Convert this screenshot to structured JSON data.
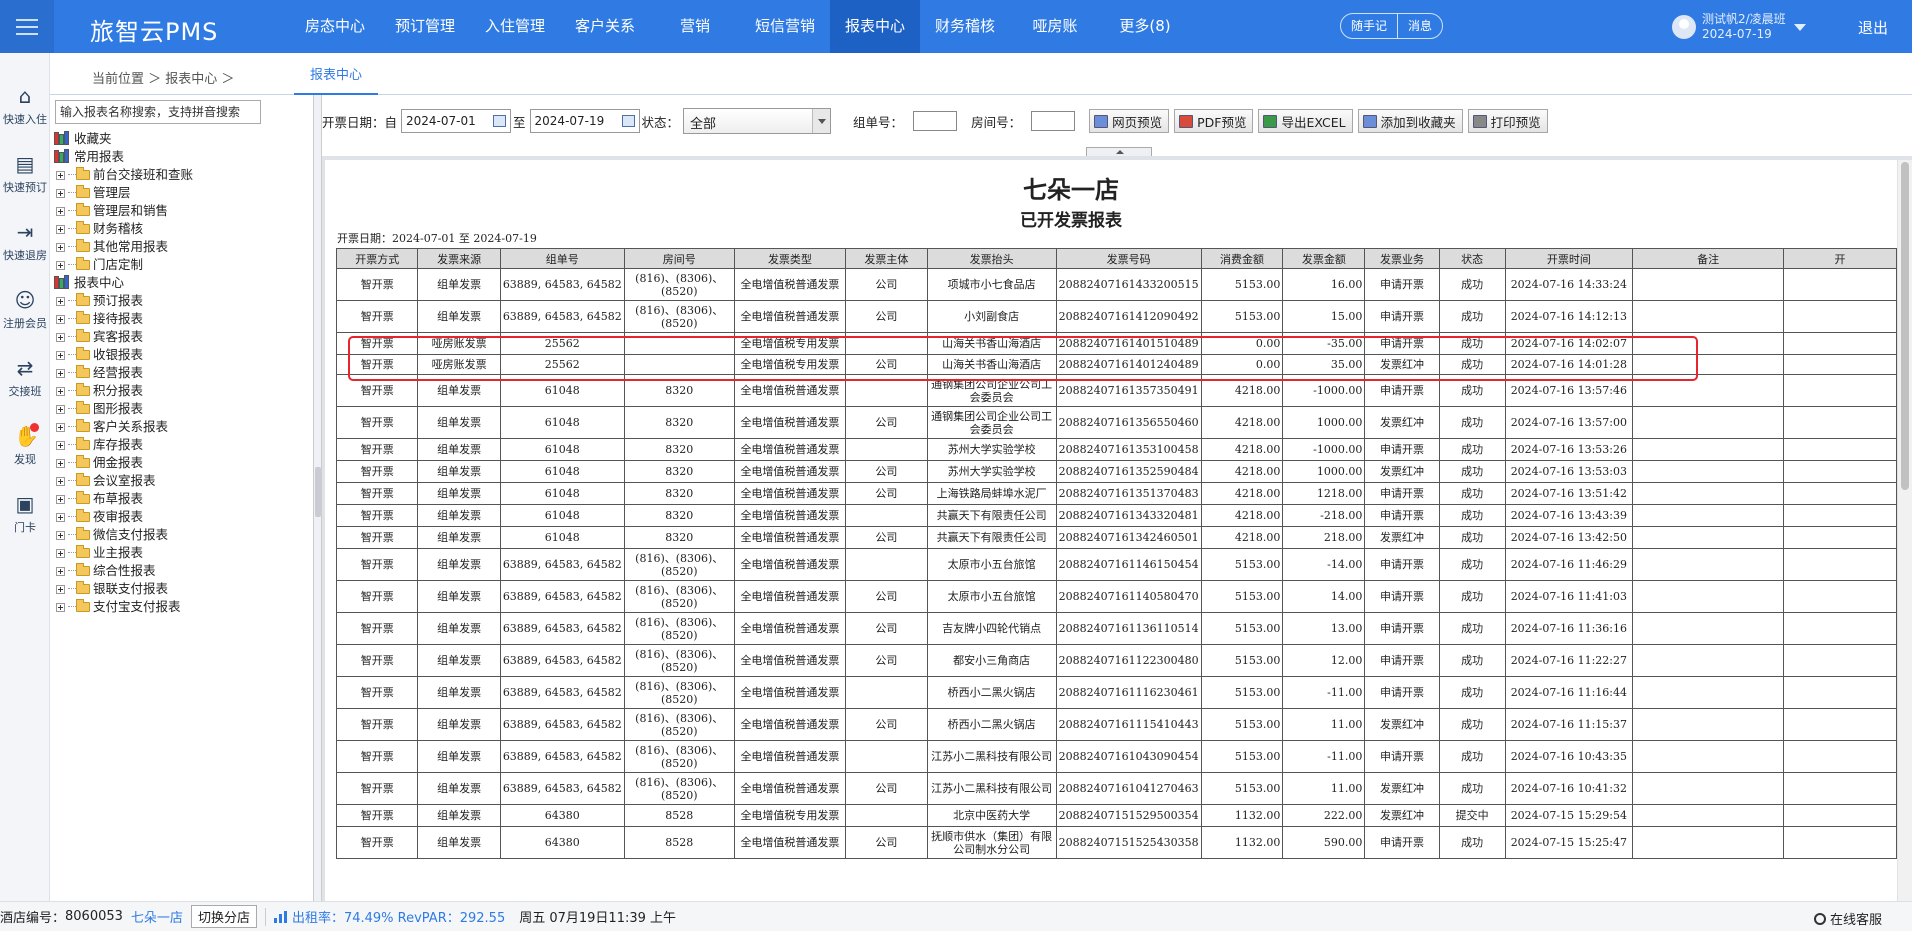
{
  "app": {
    "logo": "旅智云PMS"
  },
  "nav": {
    "items": [
      "房态中心",
      "预订管理",
      "入住管理",
      "客户关系",
      "营销",
      "短信营销",
      "报表中心",
      "财务稽核",
      "哑房账",
      "更多(8)"
    ],
    "active": 6
  },
  "quick": {
    "note": "随手记",
    "msg": "消息"
  },
  "user": {
    "name": "测试帆2/凌晨班",
    "date": "2024-07-19",
    "logout": "退出"
  },
  "leftbar": [
    {
      "label": "快速入住",
      "icon": "home-icon"
    },
    {
      "label": "快速预订",
      "icon": "booking-icon"
    },
    {
      "label": "快速退房",
      "icon": "checkout-icon"
    },
    {
      "label": "注册会员",
      "icon": "add-member-icon"
    },
    {
      "label": "交接班",
      "icon": "shift-handover-icon"
    },
    {
      "label": "发现",
      "icon": "discover-icon"
    },
    {
      "label": "门卡",
      "icon": "room-card-icon"
    }
  ],
  "breadcrumb": {
    "text": "当前位置 ＞ 报表中心 ＞",
    "tab": "报表中心"
  },
  "tree": {
    "search_placeholder": "输入报表名称搜索，支持拼音搜索",
    "favorites": "收藏夹",
    "common": "常用报表",
    "common_items": [
      "前台交接班和查账",
      "管理层",
      "管理层和销售",
      "财务稽核",
      "其他常用报表",
      "门店定制"
    ],
    "center": "报表中心",
    "center_items": [
      "预订报表",
      "接待报表",
      "宾客报表",
      "收银报表",
      "经营报表",
      "积分报表",
      "图形报表",
      "客户关系报表",
      "库存报表",
      "佣金报表",
      "会议室报表",
      "布草报表",
      "夜审报表",
      "微信支付报表",
      "业主报表",
      "综合性报表",
      "银联支付报表",
      "支付宝支付报表"
    ]
  },
  "filters": {
    "date_label": "开票日期：自",
    "start": "2024-07-01",
    "to": "至",
    "end": "2024-07-19",
    "status_label": "状态：",
    "status_value": "全部",
    "group_label": "组单号：",
    "room_label": "房间号：",
    "buttons": [
      "网页预览",
      "PDF预览",
      "导出EXCEL",
      "添加到收藏夹",
      "打印预览"
    ]
  },
  "report": {
    "title": "七朵一店",
    "subtitle": "已开发票报表",
    "range": "开票日期：2024-07-01 至 2024-07-19",
    "headers": [
      "开票方式",
      "发票来源",
      "组单号",
      "房间号",
      "发票类型",
      "发票主体",
      "发票抬头",
      "发票号码",
      "消费金额",
      "发票金额",
      "发票业务",
      "状态",
      "开票时间",
      "备注",
      "开"
    ],
    "rows": [
      [
        "智开票",
        "组单发票",
        "63889, 64583, 64582",
        "(816)、(8306)、(8520)",
        "全电增值税普通发票",
        "公司",
        "项城市小七食品店",
        "20882407161433200515",
        "5153.00",
        "16.00",
        "申请开票",
        "成功",
        "2024-07-16 14:33:24"
      ],
      [
        "智开票",
        "组单发票",
        "63889, 64583, 64582",
        "(816)、(8306)、(8520)",
        "全电增值税普通发票",
        "公司",
        "小刘副食店",
        "20882407161412090492",
        "5153.00",
        "15.00",
        "申请开票",
        "成功",
        "2024-07-16 14:12:13"
      ],
      [
        "智开票",
        "哑房账发票",
        "25562",
        "",
        "全电增值税专用发票",
        "",
        "山海关书香山海酒店",
        "20882407161401510489",
        "0.00",
        "-35.00",
        "申请开票",
        "成功",
        "2024-07-16 14:02:07"
      ],
      [
        "智开票",
        "哑房账发票",
        "25562",
        "",
        "全电增值税专用发票",
        "公司",
        "山海关书香山海酒店",
        "20882407161401240489",
        "0.00",
        "35.00",
        "发票红冲",
        "成功",
        "2024-07-16 14:01:28"
      ],
      [
        "智开票",
        "组单发票",
        "61048",
        "8320",
        "全电增值税普通发票",
        "",
        "通钢集团公司企业公司工会委员会",
        "20882407161357350491",
        "4218.00",
        "-1000.00",
        "申请开票",
        "成功",
        "2024-07-16 13:57:46"
      ],
      [
        "智开票",
        "组单发票",
        "61048",
        "8320",
        "全电增值税普通发票",
        "公司",
        "通钢集团公司企业公司工会委员会",
        "20882407161356550460",
        "4218.00",
        "1000.00",
        "发票红冲",
        "成功",
        "2024-07-16 13:57:00"
      ],
      [
        "智开票",
        "组单发票",
        "61048",
        "8320",
        "全电增值税普通发票",
        "",
        "苏州大学实验学校",
        "20882407161353100458",
        "4218.00",
        "-1000.00",
        "申请开票",
        "成功",
        "2024-07-16 13:53:26"
      ],
      [
        "智开票",
        "组单发票",
        "61048",
        "8320",
        "全电增值税普通发票",
        "公司",
        "苏州大学实验学校",
        "20882407161352590484",
        "4218.00",
        "1000.00",
        "发票红冲",
        "成功",
        "2024-07-16 13:53:03"
      ],
      [
        "智开票",
        "组单发票",
        "61048",
        "8320",
        "全电增值税普通发票",
        "公司",
        "上海铁路局蚌埠水泥厂",
        "20882407161351370483",
        "4218.00",
        "1218.00",
        "申请开票",
        "成功",
        "2024-07-16 13:51:42"
      ],
      [
        "智开票",
        "组单发票",
        "61048",
        "8320",
        "全电增值税普通发票",
        "",
        "共赢天下有限责任公司",
        "20882407161343320481",
        "4218.00",
        "-218.00",
        "申请开票",
        "成功",
        "2024-07-16 13:43:39"
      ],
      [
        "智开票",
        "组单发票",
        "61048",
        "8320",
        "全电增值税普通发票",
        "公司",
        "共赢天下有限责任公司",
        "20882407161342460501",
        "4218.00",
        "218.00",
        "发票红冲",
        "成功",
        "2024-07-16 13:42:50"
      ],
      [
        "智开票",
        "组单发票",
        "63889, 64583, 64582",
        "(816)、(8306)、(8520)",
        "全电增值税普通发票",
        "",
        "太原市小五台旅馆",
        "20882407161146150454",
        "5153.00",
        "-14.00",
        "申请开票",
        "成功",
        "2024-07-16 11:46:29"
      ],
      [
        "智开票",
        "组单发票",
        "63889, 64583, 64582",
        "(816)、(8306)、(8520)",
        "全电增值税普通发票",
        "公司",
        "太原市小五台旅馆",
        "20882407161140580470",
        "5153.00",
        "14.00",
        "申请开票",
        "成功",
        "2024-07-16 11:41:03"
      ],
      [
        "智开票",
        "组单发票",
        "63889, 64583, 64582",
        "(816)、(8306)、(8520)",
        "全电增值税普通发票",
        "公司",
        "吉友牌小四轮代销点",
        "20882407161136110514",
        "5153.00",
        "13.00",
        "申请开票",
        "成功",
        "2024-07-16 11:36:16"
      ],
      [
        "智开票",
        "组单发票",
        "63889, 64583, 64582",
        "(816)、(8306)、(8520)",
        "全电增值税普通发票",
        "公司",
        "都安小三角商店",
        "20882407161122300480",
        "5153.00",
        "12.00",
        "申请开票",
        "成功",
        "2024-07-16 11:22:27"
      ],
      [
        "智开票",
        "组单发票",
        "63889, 64583, 64582",
        "(816)、(8306)、(8520)",
        "全电增值税普通发票",
        "",
        "桥西小二黑火锅店",
        "20882407161116230461",
        "5153.00",
        "-11.00",
        "申请开票",
        "成功",
        "2024-07-16 11:16:44"
      ],
      [
        "智开票",
        "组单发票",
        "63889, 64583, 64582",
        "(816)、(8306)、(8520)",
        "全电增值税普通发票",
        "公司",
        "桥西小二黑火锅店",
        "20882407161115410443",
        "5153.00",
        "11.00",
        "发票红冲",
        "成功",
        "2024-07-16 11:15:37"
      ],
      [
        "智开票",
        "组单发票",
        "63889, 64583, 64582",
        "(816)、(8306)、(8520)",
        "全电增值税普通发票",
        "",
        "江苏小二黑科技有限公司",
        "20882407161043090454",
        "5153.00",
        "-11.00",
        "申请开票",
        "成功",
        "2024-07-16 10:43:35"
      ],
      [
        "智开票",
        "组单发票",
        "63889, 64583, 64582",
        "(816)、(8306)、(8520)",
        "全电增值税普通发票",
        "公司",
        "江苏小二黑科技有限公司",
        "20882407161041270463",
        "5153.00",
        "11.00",
        "发票红冲",
        "成功",
        "2024-07-16 10:41:32"
      ],
      [
        "智开票",
        "组单发票",
        "64380",
        "8528",
        "全电增值税专用发票",
        "",
        "北京中医药大学",
        "20882407151529500354",
        "1132.00",
        "222.00",
        "发票红冲",
        "提交中",
        "2024-07-15 15:29:54"
      ],
      [
        "智开票",
        "组单发票",
        "64380",
        "8528",
        "全电增值税普通发票",
        "公司",
        "抚顺市供水（集团）有限公司制水分公司",
        "20882407151525430358",
        "1132.00",
        "590.00",
        "申请开票",
        "成功",
        "2024-07-15 15:25:47"
      ]
    ]
  },
  "status": {
    "hotel_label": "酒店编号：",
    "hotel_no": "8060053",
    "store": "七朵一店",
    "switch": "切换分店",
    "occupancy": "出租率：74.49% RevPAR：292.55",
    "datetime": "周五 07月19日11:39 上午",
    "service": "在线客服"
  }
}
